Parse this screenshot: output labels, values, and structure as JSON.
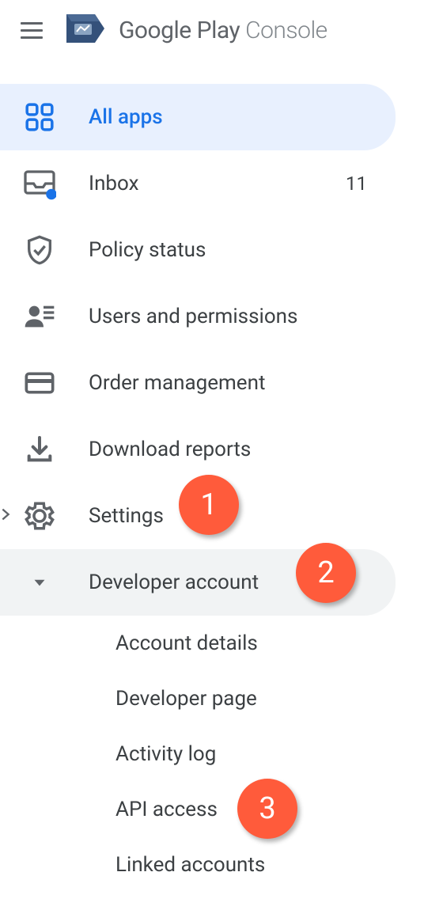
{
  "header": {
    "brand_primary": "Google Play",
    "brand_secondary": "Console"
  },
  "nav": {
    "all_apps": "All apps",
    "inbox": "Inbox",
    "inbox_count": "11",
    "policy_status": "Policy status",
    "users_permissions": "Users and permissions",
    "order_management": "Order management",
    "download_reports": "Download reports",
    "settings": "Settings",
    "developer_account": "Developer account",
    "account_details": "Account details",
    "developer_page": "Developer page",
    "activity_log": "Activity log",
    "api_access": "API access",
    "linked_accounts": "Linked accounts"
  },
  "annotations": {
    "a1": "1",
    "a2": "2",
    "a3": "3"
  },
  "colors": {
    "accent": "#1a73e8",
    "active_bg": "#e8f0fe",
    "text": "#3c4043",
    "icon": "#5f6368",
    "annotation": "#ff5b3b"
  }
}
